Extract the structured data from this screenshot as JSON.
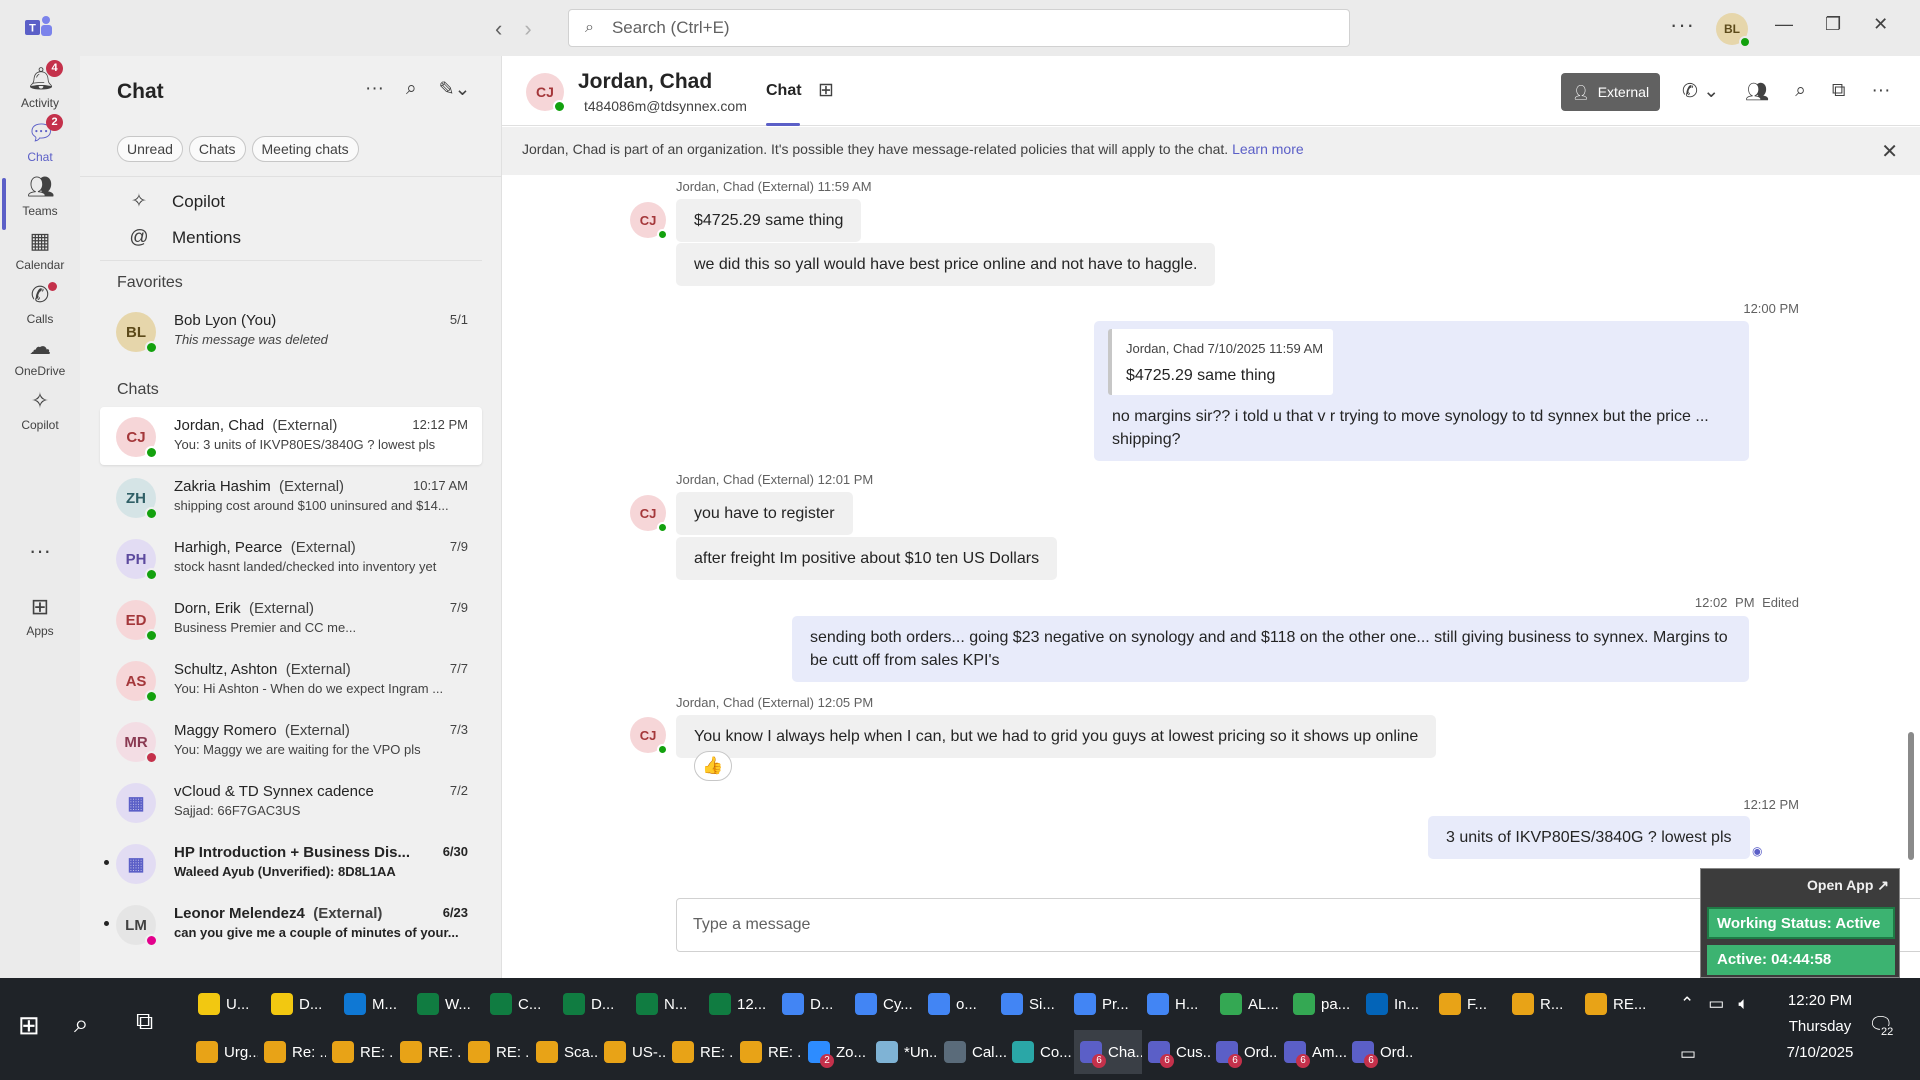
{
  "titlebar": {
    "search_placeholder": "Search (Ctrl+E)",
    "user_initials": "BL"
  },
  "rail": {
    "items": [
      {
        "label": "Activity",
        "badge": "4"
      },
      {
        "label": "Chat",
        "badge": "2"
      },
      {
        "label": "Teams"
      },
      {
        "label": "Calendar"
      },
      {
        "label": "Calls"
      },
      {
        "label": "OneDrive"
      },
      {
        "label": "Copilot"
      },
      {
        "label": "Apps"
      }
    ]
  },
  "chatlist": {
    "title": "Chat",
    "filters": [
      "Unread",
      "Chats",
      "Meeting chats"
    ],
    "nav": [
      {
        "label": "Copilot"
      },
      {
        "label": "Mentions"
      }
    ],
    "favorites_label": "Favorites",
    "favorites": [
      {
        "initials": "BL",
        "name": "Bob Lyon (You)",
        "time": "5/1",
        "preview": "This message was deleted",
        "avatar_bg": "#e6d6ab",
        "avatar_fg": "#5c4a1a",
        "status": "#13a10e"
      }
    ],
    "chats_label": "Chats",
    "chats": [
      {
        "initials": "CJ",
        "name": "Jordan, Chad",
        "ext": "(External)",
        "time": "12:12 PM",
        "preview": "You: 3 units of IKVP80ES/3840G ? lowest pls",
        "avatar_bg": "#f6d6d8",
        "avatar_fg": "#a4373a",
        "status": "#13a10e"
      },
      {
        "initials": "ZH",
        "name": "Zakria Hashim",
        "ext": "(External)",
        "time": "10:17 AM",
        "preview": "shipping cost around $100 uninsured and $14...",
        "avatar_bg": "#d5e4e6",
        "avatar_fg": "#2f5f66",
        "status": "#13a10e"
      },
      {
        "initials": "PH",
        "name": "Harhigh, Pearce",
        "ext": "(External)",
        "time": "7/9",
        "preview": "stock hasnt landed/checked into inventory yet",
        "avatar_bg": "#e2dcf3",
        "avatar_fg": "#5c4a9e",
        "status": "#13a10e"
      },
      {
        "initials": "ED",
        "name": "Dorn, Erik",
        "ext": "(External)",
        "time": "7/9",
        "preview": "Business Premier and CC me...",
        "avatar_bg": "#f6d6d8",
        "avatar_fg": "#a4373a",
        "status": "#13a10e"
      },
      {
        "initials": "AS",
        "name": "Schultz, Ashton",
        "ext": "(External)",
        "time": "7/7",
        "preview": "You: Hi Ashton -  When do we expect Ingram ...",
        "avatar_bg": "#f6d6d8",
        "avatar_fg": "#a4373a",
        "status": "#13a10e"
      },
      {
        "initials": "MR",
        "name": "Maggy Romero",
        "ext": "(External)",
        "time": "7/3",
        "preview": "You: Maggy we are waiting for the VPO pls",
        "avatar_bg": "#f3dde4",
        "avatar_fg": "#8a3a52",
        "status": "#c4314b"
      },
      {
        "initials": "",
        "name": "vCloud & TD Synnex cadence",
        "ext": "",
        "time": "7/2",
        "preview": "Sajjad: 66F7GAC3US",
        "avatar_bg": "#e2dcf3",
        "avatar_fg": "#5b5fc7",
        "status": ""
      },
      {
        "initials": "",
        "name": "HP Introduction + Business Dis...",
        "ext": "",
        "time": "6/30",
        "preview": "Waleed Ayub (Unverified): 8D8L1AA",
        "avatar_bg": "#e2dcf3",
        "avatar_fg": "#5b5fc7",
        "status": "",
        "unread": true
      },
      {
        "initials": "LM",
        "name": "Leonor Melendez4",
        "ext": "(External)",
        "time": "6/23",
        "preview": "can you give me a couple of minutes of your...",
        "avatar_bg": "#e5e5e5",
        "avatar_fg": "#424242",
        "status": "#e3008c",
        "unread": true
      }
    ]
  },
  "conversation": {
    "initials": "CJ",
    "name": "Jordan, Chad",
    "email": "t484086m@tdsynnex.com",
    "tab": "Chat",
    "external_label": "External",
    "banner_text": "Jordan, Chad is part of an organization. It's possible they have message-related policies that will apply to the chat.",
    "banner_link": "Learn more",
    "messages": [
      {
        "meta": "Jordan, Chad (External)   11:59 AM",
        "lines": [
          "$4725.29 same thing",
          "we did this so yall would have best price online and not have to haggle."
        ]
      },
      {
        "meta": "12:00 PM",
        "quote_head": "Jordan, Chad   7/10/2025 11:59 AM",
        "quote_text": "$4725.29 same thing",
        "text": "no margins sir?? i told u that v r trying to move synology to td synnex but the price ... shipping?"
      },
      {
        "meta": "Jordan, Chad (External)   12:01 PM",
        "lines": [
          "you have to register",
          "after freight Im positive about $10 ten US Dollars"
        ]
      },
      {
        "meta": "12:02 PM   Edited",
        "text": "sending both orders... going $23 negative on synology and and $118 on the other one... still giving business to synnex. Margins to be cutt off from sales KPI's"
      },
      {
        "meta": "Jordan, Chad (External)   12:05 PM",
        "lines": [
          "You know I always help when I can, but we had to grid you guys at lowest pricing so it shows up online"
        ],
        "reaction": "👍"
      },
      {
        "meta": "12:12 PM",
        "text": "3 units of IKVP80ES/3840G ? lowest pls"
      }
    ],
    "compose_placeholder": "Type a message"
  },
  "widget": {
    "open_label": "Open App ↗",
    "status": "Working Status: Active",
    "active": "Active: 04:44:58"
  },
  "taskbar": {
    "row1": [
      {
        "label": "U...",
        "color": "#f2c811"
      },
      {
        "label": "D...",
        "color": "#f2c811"
      },
      {
        "label": "M...",
        "color": "#0f78d4"
      },
      {
        "label": "W...",
        "color": "#107c41"
      },
      {
        "label": "C...",
        "color": "#107c41"
      },
      {
        "label": "D...",
        "color": "#107c41"
      },
      {
        "label": "N...",
        "color": "#107c41"
      },
      {
        "label": "12...",
        "color": "#107c41"
      },
      {
        "label": "D...",
        "color": "#4285f4"
      },
      {
        "label": "Cy...",
        "color": "#4285f4"
      },
      {
        "label": "o...",
        "color": "#4285f4"
      },
      {
        "label": "Si...",
        "color": "#4285f4"
      },
      {
        "label": "Pr...",
        "color": "#4285f4"
      },
      {
        "label": "H...",
        "color": "#4285f4"
      },
      {
        "label": "AL...",
        "color": "#34a853"
      },
      {
        "label": "pa...",
        "color": "#34a853"
      },
      {
        "label": "In...",
        "color": "#0364b8"
      },
      {
        "label": "F...",
        "color": "#e8a317"
      },
      {
        "label": "R...",
        "color": "#e8a317"
      },
      {
        "label": "RE...",
        "color": "#e8a317"
      }
    ],
    "row2": [
      {
        "label": "Urg...",
        "color": "#e8a317"
      },
      {
        "label": "Re: ...",
        "color": "#e8a317"
      },
      {
        "label": "RE: ...",
        "color": "#e8a317"
      },
      {
        "label": "RE: ...",
        "color": "#e8a317"
      },
      {
        "label": "RE: ...",
        "color": "#e8a317"
      },
      {
        "label": "Sca...",
        "color": "#e8a317"
      },
      {
        "label": "US-...",
        "color": "#e8a317"
      },
      {
        "label": "RE: ...",
        "color": "#e8a317"
      },
      {
        "label": "RE: ...",
        "color": "#e8a317"
      },
      {
        "label": "Zo...",
        "color": "#2d8cff",
        "badge": "2"
      },
      {
        "label": "*Un...",
        "color": "#7fb3d5"
      },
      {
        "label": "Cal...",
        "color": "#5a6b7a"
      },
      {
        "label": "Co...",
        "color": "#2aa7a7"
      },
      {
        "label": "Cha...",
        "color": "#5b5fc7",
        "badge": "6",
        "active": true
      },
      {
        "label": "Cus...",
        "color": "#5b5fc7",
        "badge": "6"
      },
      {
        "label": "Ord...",
        "color": "#5b5fc7",
        "badge": "6"
      },
      {
        "label": "Am...",
        "color": "#5b5fc7",
        "badge": "6"
      },
      {
        "label": "Ord...",
        "color": "#5b5fc7",
        "badge": "6"
      }
    ],
    "time": "12:20 PM",
    "day": "Thursday",
    "date": "7/10/2025",
    "notifications": "22"
  }
}
